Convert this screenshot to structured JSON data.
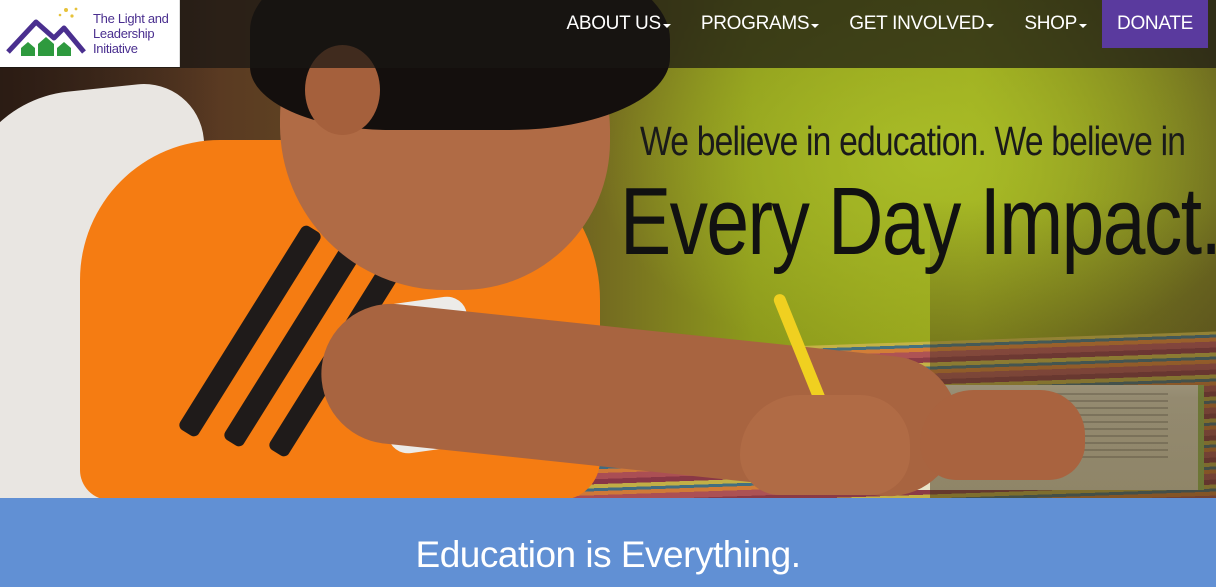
{
  "logo": {
    "text_line1": "The Light and",
    "text_line2": "Leadership",
    "text_line3": "Initiative",
    "icon": "mountain-houses-stars-icon",
    "colors": {
      "mountain": "#4a2f8f",
      "houses": "#2e9a3e",
      "stars": "#e6c23a"
    }
  },
  "nav": {
    "items": [
      {
        "label": "ABOUT US",
        "has_dropdown": true
      },
      {
        "label": "PROGRAMS",
        "has_dropdown": true
      },
      {
        "label": "GET INVOLVED",
        "has_dropdown": true
      },
      {
        "label": "SHOP",
        "has_dropdown": true
      }
    ],
    "donate_label": "DONATE",
    "donate_color": "#5a3a9e"
  },
  "hero": {
    "tagline_line1": "We believe in education. We believe in",
    "tagline_line2": "Every Day Impact."
  },
  "band": {
    "title": "Education is Everything.",
    "color": "#6190d4"
  }
}
